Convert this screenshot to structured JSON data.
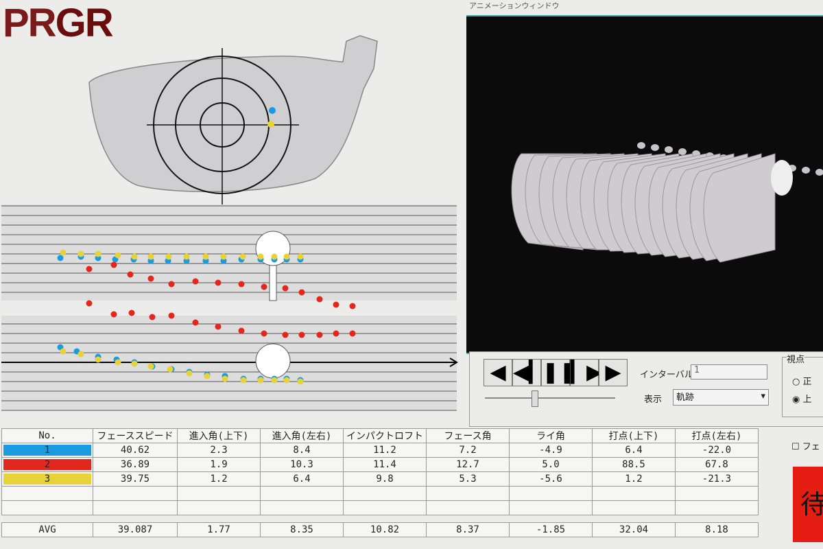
{
  "logo": {
    "pr": "PR",
    "gr": "GR"
  },
  "animation": {
    "title": "アニメーションウィンドウ",
    "controls": {
      "interval_label": "インターバル",
      "interval_value": "1",
      "display_label": "表示",
      "display_value": "軌跡"
    },
    "viewpoint": {
      "title": "視点",
      "option1": "正",
      "option2": "上"
    },
    "playback_icons": [
      "prev-frame-icon",
      "rewind-icon",
      "pause-icon",
      "play-icon",
      "next-frame-icon"
    ]
  },
  "swing_colors": {
    "1": "#1a9be0",
    "2": "#e2281e",
    "3": "#e8d23a"
  },
  "table": {
    "headers": [
      "No.",
      "フェーススピード",
      "進入角(上下)",
      "進入角(左右)",
      "インパクトロフト",
      "フェース角",
      "ライ角",
      "打点(上下)",
      "打点(左右)"
    ],
    "rows": [
      {
        "no": "1",
        "color": "#1a9be0",
        "values": [
          "40.62",
          "2.3",
          "8.4",
          "11.2",
          "7.2",
          "-4.9",
          "6.4",
          "-22.0"
        ]
      },
      {
        "no": "2",
        "color": "#e2281e",
        "values": [
          "36.89",
          "1.9",
          "10.3",
          "11.4",
          "12.7",
          "5.0",
          "88.5",
          "67.8"
        ]
      },
      {
        "no": "3",
        "color": "#e8d23a",
        "values": [
          "39.75",
          "1.2",
          "6.4",
          "9.8",
          "5.3",
          "-5.6",
          "1.2",
          "-21.3"
        ]
      }
    ],
    "avg_label": "AVG",
    "avg_values": [
      "39.087",
      "1.77",
      "8.35",
      "10.82",
      "8.37",
      "-1.85",
      "32.04",
      "8.18"
    ]
  },
  "side": {
    "checkbox_label": "フェ",
    "action_button": "待"
  }
}
